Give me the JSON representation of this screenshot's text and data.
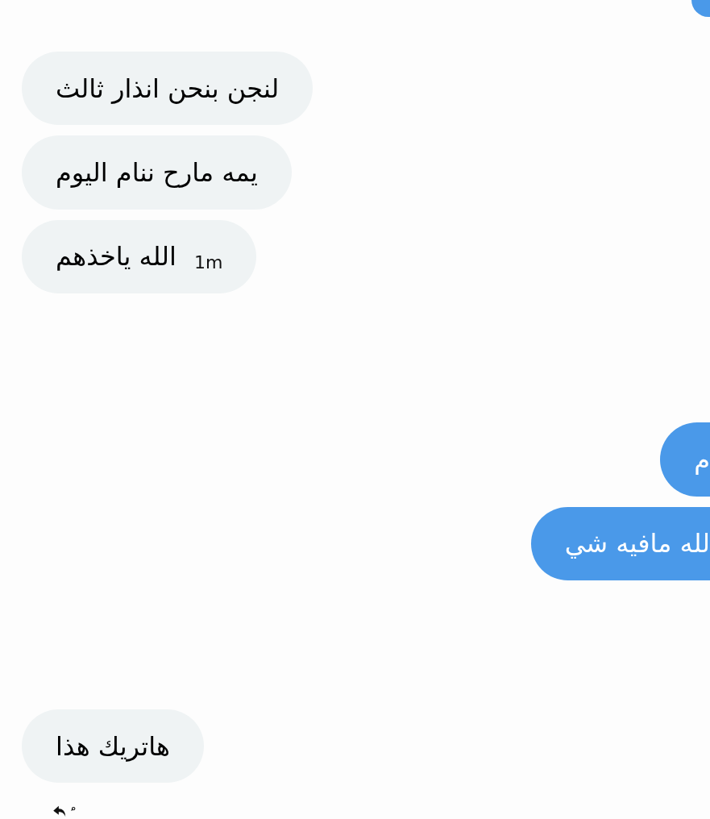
{
  "messages": [
    {
      "kind": "sent_fragment"
    },
    {
      "kind": "received",
      "text": "لنجن بنحن انذار ثالث"
    },
    {
      "kind": "received",
      "text": "يمه مارح ننام اليوم"
    },
    {
      "kind": "received",
      "text": "الله ياخذهم",
      "time": "1m"
    },
    {
      "kind": "sent",
      "text": "م"
    },
    {
      "kind": "sent",
      "text": "لله مافيه شي"
    },
    {
      "kind": "received",
      "text": "هاتريك هذا"
    }
  ]
}
